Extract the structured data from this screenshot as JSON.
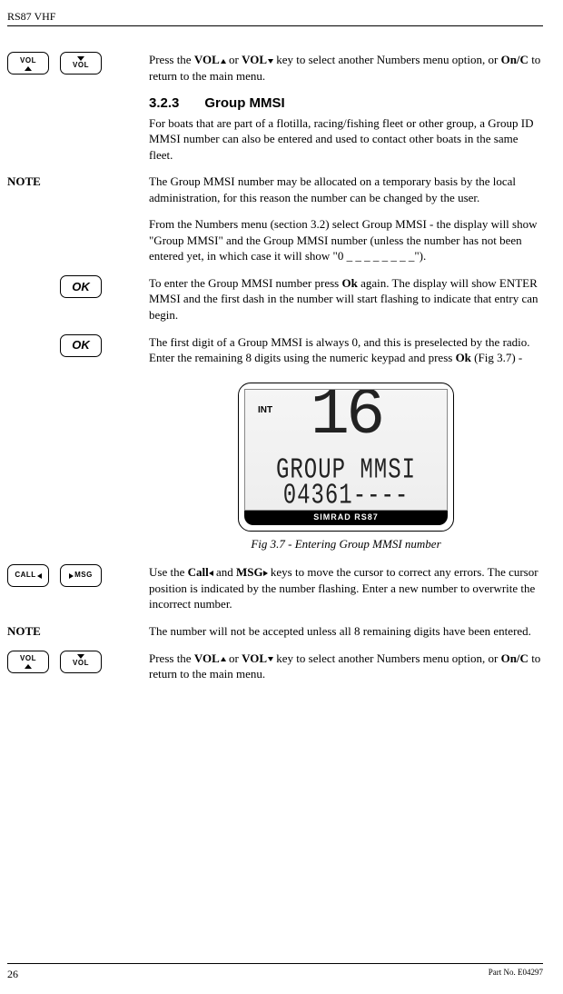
{
  "header": {
    "title": "RS87 VHF"
  },
  "buttons": {
    "vol": "VOL",
    "ok": "OK",
    "call": "CALL",
    "msg": "MSG"
  },
  "p1": {
    "a": "Press the ",
    "vol": "VOL",
    "b": " or ",
    "c": " key to select another Numbers menu option, or ",
    "onc": "On/C",
    "d": " to return to the main menu."
  },
  "section": {
    "num": "3.2.3",
    "title": "Group MMSI",
    "intro": "For boats that are part of a flotilla, racing/fishing fleet or other group, a Group ID MMSI number can also be entered and used to contact other boats in the same fleet."
  },
  "note1": {
    "label": "NOTE",
    "text": "The Group MMSI number may be allocated on a temporary basis by the local administration, for this reason the number can be changed by the user."
  },
  "p2": "From the Numbers menu (section 3.2) select Group MMSI  - the display will show \"Group MMSI\" and the Group MMSI number (unless the number has not been entered yet, in which case it will show \"0 _ _ _ _ _ _ _ _\").",
  "p3": {
    "a": "To enter the Group MMSI number press ",
    "ok": "Ok",
    "b": " again.  The display will show ENTER MMSI and the first dash in the number will start flashing to indicate that entry can begin."
  },
  "p4": {
    "a": "The first digit of a Group MMSI is always 0, and this is preselected by the radio.  Enter the remaining 8 digits using the numeric keypad and press ",
    "ok": "Ok",
    "b": " (Fig 3.7) -"
  },
  "lcd": {
    "int": "INT",
    "big": "16",
    "line1": "GROUP MMSI",
    "line2": "04361----",
    "brand": "SIMRAD RS87"
  },
  "figcaption": "Fig 3.7 - Entering Group MMSI number",
  "p5": {
    "a": "Use the ",
    "call": "Call",
    "b": " and ",
    "msg": "MSG",
    "c": " keys to move the cursor to correct any errors.  The cursor position is indicated by the number flashing.  Enter a new number to overwrite the incorrect number."
  },
  "note2": {
    "label": "NOTE",
    "text": "The number will not be accepted unless all 8 remaining digits have been entered."
  },
  "p6": {
    "a": "Press the ",
    "vol": "VOL",
    "b": " or ",
    "c": " key to select another Numbers menu option, or ",
    "onc": "On/C",
    "d": " to return to the main menu."
  },
  "footer": {
    "page": "26",
    "part": "Part No. E04297"
  }
}
